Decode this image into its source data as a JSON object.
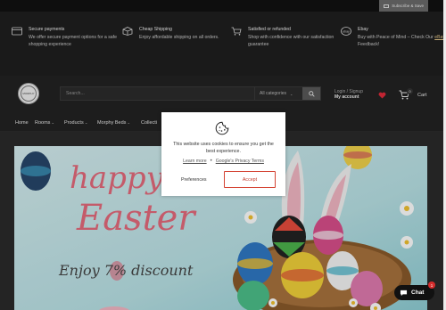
{
  "topbar": {
    "subscribe_label": "Subscribe & Save"
  },
  "features": [
    {
      "title": "Secure payments",
      "desc": "We offer secure payment options for a safe shopping experience"
    },
    {
      "title": "Cheap Shipping",
      "desc": "Enjoy affordable shipping on all orders."
    },
    {
      "title": "Satisfied or refunded",
      "desc": "Shop with confidence with our satisfaction guarantee"
    },
    {
      "title": "Ebay",
      "desc_pre": "Buy with Peace of Mind – Check Our",
      "desc_link": "eBay",
      "desc_post": "Feedback!"
    }
  ],
  "header": {
    "logo_text": "MORPHY",
    "search_placeholder": "Search...",
    "category_select": "All categories",
    "account_line1": "Login / Signup",
    "account_line2": "My account",
    "cart_count": "0",
    "cart_label": "Cart"
  },
  "nav": {
    "items": [
      "Home",
      "Rooms",
      "Products",
      "Morphy Beds",
      "Collecti"
    ]
  },
  "hero": {
    "line1": "happy",
    "line2": "Easter",
    "line3": "Enjoy 7% discount"
  },
  "cookie": {
    "message": "This website uses cookies to ensure you get the best experience.",
    "learn_more": "Learn more",
    "privacy": "Google's Privacy Terms",
    "preferences": "Preferences",
    "accept": "Accept"
  },
  "chat": {
    "label": "Chat",
    "badge": "1"
  },
  "colors": {
    "accent": "#d44333",
    "dark": "#222222",
    "feature_bg": "#1f1f1f"
  }
}
